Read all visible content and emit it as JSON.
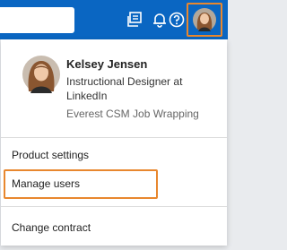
{
  "header": {
    "search_value": "",
    "icons": [
      "messaging-icon",
      "notifications-icon",
      "help-icon",
      "avatar"
    ]
  },
  "profile": {
    "name": "Kelsey Jensen",
    "title": "Instructional Designer at LinkedIn",
    "company": "Everest CSM Job Wrapping"
  },
  "menu": {
    "product_settings": "Product settings",
    "manage_users": "Manage users",
    "change_contract": "Change contract"
  },
  "colors": {
    "topbar": "#0a66c2",
    "highlight": "#e8872e"
  }
}
